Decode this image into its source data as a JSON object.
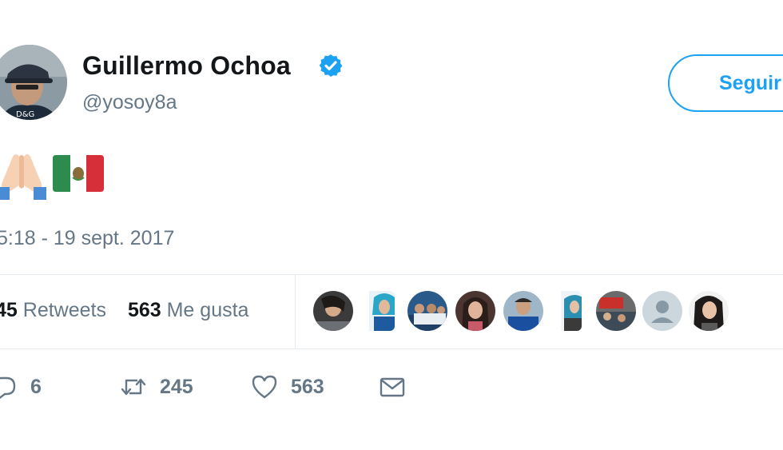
{
  "user": {
    "display_name": "Guillermo Ochoa",
    "handle": "@yosoy8a",
    "verified_icon": "verified-badge-icon",
    "avatar_icon": "user-avatar"
  },
  "follow_button": {
    "label": "Seguir"
  },
  "tweet": {
    "emojis": [
      "folded-hands-emoji",
      "mexico-flag-emoji"
    ],
    "timestamp": "5:18 - 19 sept. 2017"
  },
  "stats": {
    "retweets_count": "45",
    "retweets_label": "Retweets",
    "likes_count": "563",
    "likes_label": "Me gusta"
  },
  "likers": [
    {
      "icon": "liker-avatar-1"
    },
    {
      "icon": "liker-avatar-2"
    },
    {
      "icon": "liker-avatar-3"
    },
    {
      "icon": "liker-avatar-4"
    },
    {
      "icon": "liker-avatar-5"
    },
    {
      "icon": "liker-avatar-6"
    },
    {
      "icon": "liker-avatar-7"
    },
    {
      "icon": "liker-avatar-default"
    },
    {
      "icon": "liker-avatar-9"
    }
  ],
  "actions": {
    "reply": {
      "icon": "reply-icon",
      "count": "6"
    },
    "retweet": {
      "icon": "retweet-icon",
      "count": "245"
    },
    "like": {
      "icon": "heart-icon",
      "count": "563"
    },
    "dm": {
      "icon": "envelope-icon"
    }
  },
  "colors": {
    "accent": "#1da1f2",
    "text_primary": "#14171a",
    "text_secondary": "#657786",
    "divider": "#e6ecf0"
  }
}
